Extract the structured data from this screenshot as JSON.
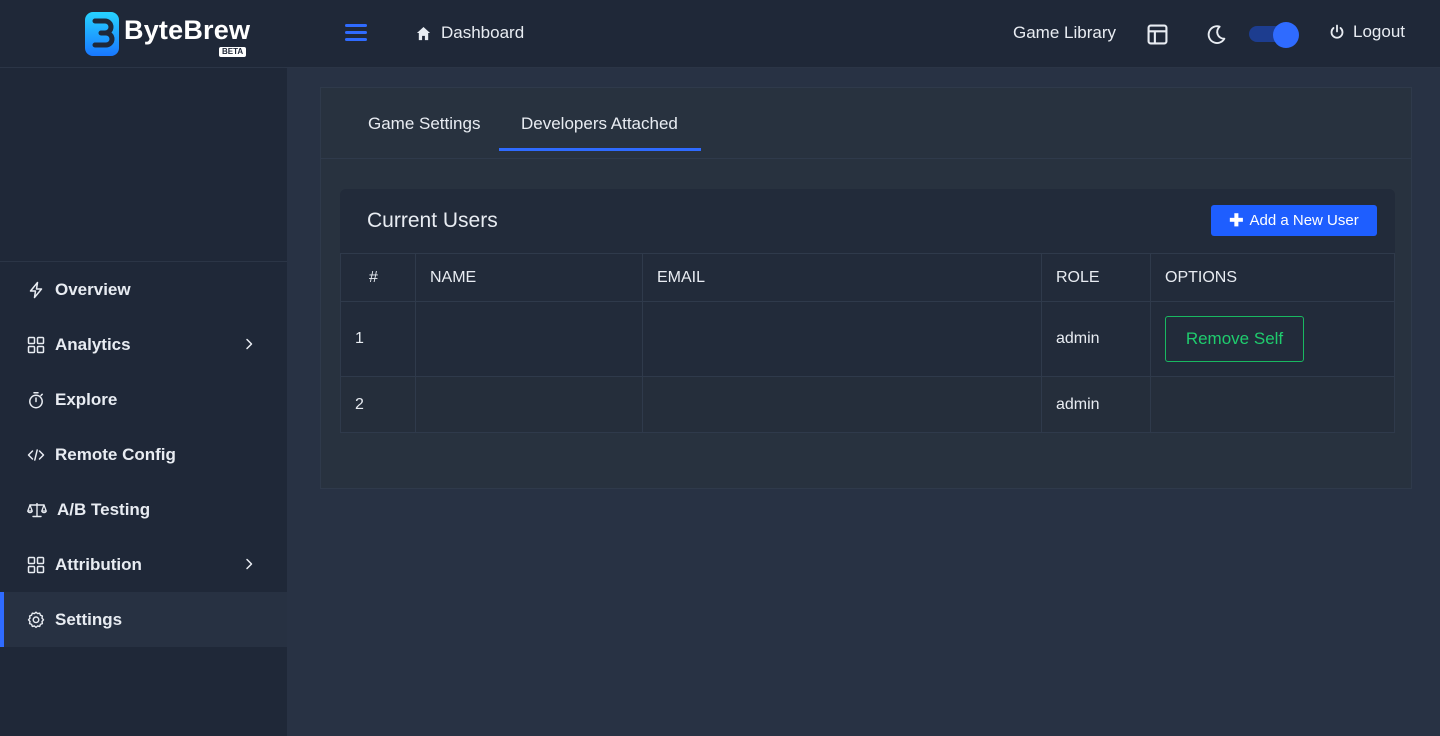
{
  "brand": {
    "name": "ByteBrew",
    "badge": "BETA",
    "logo_icon": "bytebrew-logo-icon",
    "accent": "#2f6bff"
  },
  "header": {
    "menu_icon": "hamburger-icon",
    "breadcrumb": {
      "icon": "home-icon",
      "label": "Dashboard"
    },
    "game_library_label": "Game Library",
    "layout_icon": "layout-icon",
    "theme_icon": "moon-icon",
    "theme_toggle_on": true,
    "logout": {
      "icon": "power-icon",
      "label": "Logout"
    }
  },
  "sidebar": {
    "items": [
      {
        "label": "Overview",
        "icon": "bolt-icon",
        "has_submenu": false,
        "active": false
      },
      {
        "label": "Analytics",
        "icon": "grid-icon",
        "has_submenu": true,
        "active": false
      },
      {
        "label": "Explore",
        "icon": "stopwatch-icon",
        "has_submenu": false,
        "active": false
      },
      {
        "label": "Remote Config",
        "icon": "code-icon",
        "has_submenu": false,
        "active": false
      },
      {
        "label": "A/B Testing",
        "icon": "scale-icon",
        "has_submenu": false,
        "active": false
      },
      {
        "label": "Attribution",
        "icon": "grid-icon",
        "has_submenu": true,
        "active": false
      },
      {
        "label": "Settings",
        "icon": "gear-icon",
        "has_submenu": false,
        "active": true
      }
    ]
  },
  "main": {
    "tabs": [
      {
        "label": "Game Settings",
        "active": false
      },
      {
        "label": "Developers Attached",
        "active": true
      }
    ],
    "users": {
      "title": "Current Users",
      "add_button_label": "Add a New User",
      "columns": [
        "#",
        "NAME",
        "EMAIL",
        "ROLE",
        "OPTIONS"
      ],
      "rows": [
        {
          "index": "1",
          "name": "",
          "email": "",
          "role": "admin",
          "option": "Remove Self"
        },
        {
          "index": "2",
          "name": "",
          "email": "",
          "role": "admin",
          "option": ""
        }
      ]
    }
  }
}
